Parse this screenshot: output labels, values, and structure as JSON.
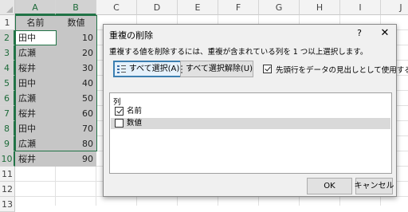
{
  "sheet": {
    "columns": [
      "A",
      "B",
      "C",
      "D",
      "E",
      "F",
      "G",
      "H",
      "I",
      "J"
    ],
    "rows": [
      "1",
      "2",
      "3",
      "4",
      "5",
      "6",
      "7",
      "8",
      "9",
      "10",
      "11",
      "12",
      "13"
    ],
    "header_row": [
      "名前",
      "数値"
    ],
    "data": [
      [
        "田中",
        "10"
      ],
      [
        "広瀬",
        "20"
      ],
      [
        "桜井",
        "30"
      ],
      [
        "田中",
        "40"
      ],
      [
        "広瀬",
        "50"
      ],
      [
        "桜井",
        "60"
      ],
      [
        "田中",
        "70"
      ],
      [
        "広瀬",
        "80"
      ],
      [
        "桜井",
        "90"
      ]
    ],
    "colors": {
      "selection": "#217346",
      "highlight": "#c6c6c6"
    }
  },
  "dialog": {
    "title": "重複の削除",
    "help": "?",
    "close": "✕",
    "instruction": "重複する値を削除するには、重複が含まれている列を 1 つ以上選択します。",
    "select_all": "すべて選択(A)",
    "unselect_all": "すべて選択解除(U)",
    "has_headers_label": "先頭行をデータの見出しとして使用する(M)",
    "has_headers_checked": true,
    "list_title": "列",
    "columns": [
      {
        "label": "名前",
        "checked": true
      },
      {
        "label": "数値",
        "checked": false
      }
    ],
    "ok": "OK",
    "cancel": "キャンセル"
  }
}
